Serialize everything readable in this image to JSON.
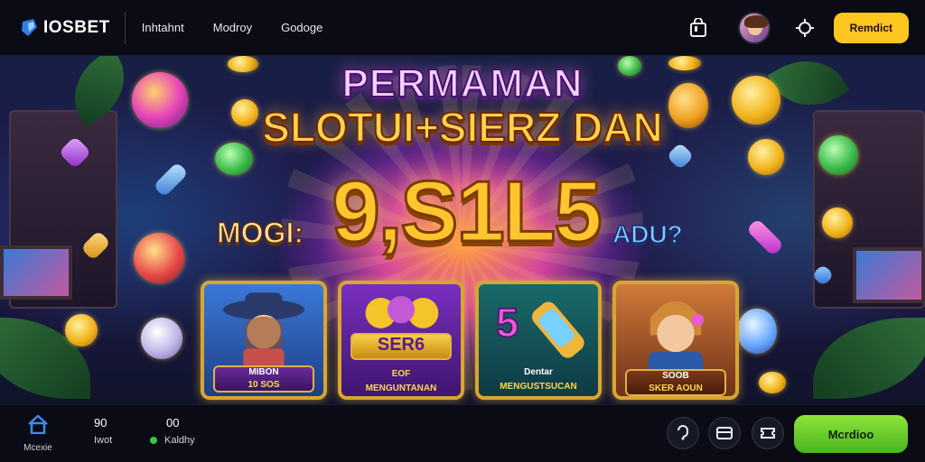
{
  "header": {
    "brand": "IOSBET",
    "nav": [
      "Inhtahnt",
      "Modroy",
      "Godoge"
    ],
    "register_label": "Remdict",
    "icons": [
      "bag-icon",
      "avatar",
      "settings-icon"
    ]
  },
  "banner": {
    "line1": "PERMAMAN",
    "line2": "SLOTUI+SIERZ DAN",
    "big_amount": "9,S1L5",
    "left_text": "MOGI:",
    "right_text": "ADU?",
    "cards": [
      {
        "title": "MIBON",
        "subtitle": "10 SOS"
      },
      {
        "title": "SER6",
        "subtitle": "EOF",
        "footer": "MENGUNTANAN"
      },
      {
        "title": "5",
        "subtitle": "Dentar",
        "footer": "MENGUSTSUCAN"
      },
      {
        "title": "SOOB",
        "subtitle": "SKER AOUN"
      }
    ]
  },
  "footer": {
    "home_label": "Mcexie",
    "stats": [
      {
        "value": "90",
        "label": "Iwot"
      },
      {
        "value": "00",
        "label": "Kaldhy"
      }
    ],
    "play_label": "Mcrdioo"
  },
  "colors": {
    "accent_yellow": "#fdc620",
    "accent_green": "#5cc626",
    "background": "#0a0b14"
  }
}
